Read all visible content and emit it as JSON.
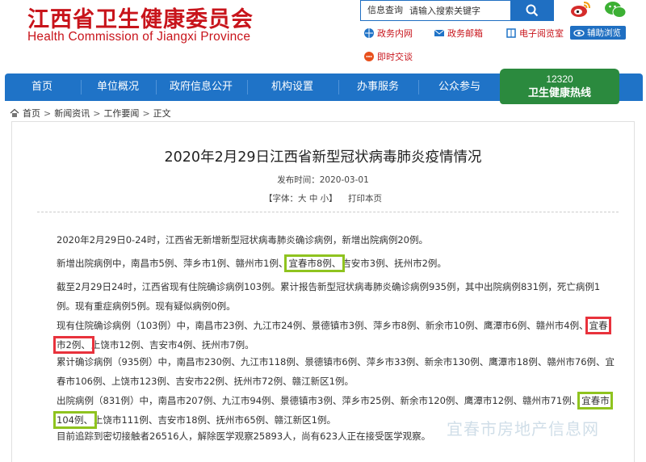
{
  "header": {
    "title_cn": "江西省卫生健康委员会",
    "title_en": "Health Commission of Jiangxi Province",
    "search": {
      "label": "信息查询",
      "placeholder": "请输入搜索关键字"
    },
    "quick_links": [
      "政务内网",
      "政务邮箱",
      "电子阅览室",
      "辅助浏览",
      "即时交谈"
    ]
  },
  "nav": {
    "items": [
      "首页",
      "单位概况",
      "政府信息公开",
      "机构设置",
      "办事服务",
      "公众参与"
    ],
    "hotline_number": "12320",
    "hotline_label": "卫生健康热线"
  },
  "breadcrumb": [
    "首页",
    "新闻资讯",
    "工作要闻",
    "正文"
  ],
  "article": {
    "title": "2020年2月29日江西省新型冠状病毒肺炎疫情情况",
    "date_label": "发布时间：2020-03-01",
    "font_label": "【字体：",
    "font_sizes": [
      "大",
      "中",
      "小"
    ],
    "font_close": "】",
    "print_label": "打印本页",
    "p1": "2020年2月29日0-24时，江西省无新增新型冠状病毒肺炎确诊病例，新增出院病例20例。",
    "p2_a": "新增出院病例中，南昌市5例、萍乡市1例、赣州市1例、",
    "p2_hl": "宜春市8例、",
    "p2_b": "吉安市3例、抚州市2例。",
    "p3": "截至2月29日24时，江西省现有住院确诊病例103例。累计报告新型冠状病毒肺炎确诊病例935例，其中出院病例831例，死亡病例1例。现有重症病例5例。现有疑似病例0例。",
    "p4_a": "现有住院确诊病例（103例）中，南昌市23例、九江市24例、景德镇市3例、萍乡市8例、新余市10例、鹰潭市6例、赣州市4例、",
    "p4_hl": "宜春市2例、",
    "p4_b": "上饶市12例、吉安市4例、抚州市7例。",
    "p5": "累计确诊病例（935例）中，南昌市230例、九江市118例、景德镇市6例、萍乡市33例、新余市130例、鹰潭市18例、赣州市76例、宜春市106例、上饶市123例、吉安市22例、抚州市72例、赣江新区1例。",
    "p6_a": "出院病例（831例）中，南昌市207例、九江市94例、景德镇市3例、萍乡市25例、新余市120例、鹰潭市12例、赣州市71例、",
    "p6_hl": "宜春市104例、",
    "p6_b": "上饶市111例、吉安市18例、抚州市65例、赣江新区1例。",
    "p7": "目前追踪到密切接触者26516人，解除医学观察25893人，尚有623人正在接受医学观察。"
  },
  "watermark": "宜春市房地产信息网",
  "colors": {
    "brand_red": "#c8141b",
    "nav_blue": "#1f73c7",
    "hotline_green": "#2b8a3e",
    "highlight_green": "#8fc31f",
    "highlight_red": "#e8323c"
  }
}
